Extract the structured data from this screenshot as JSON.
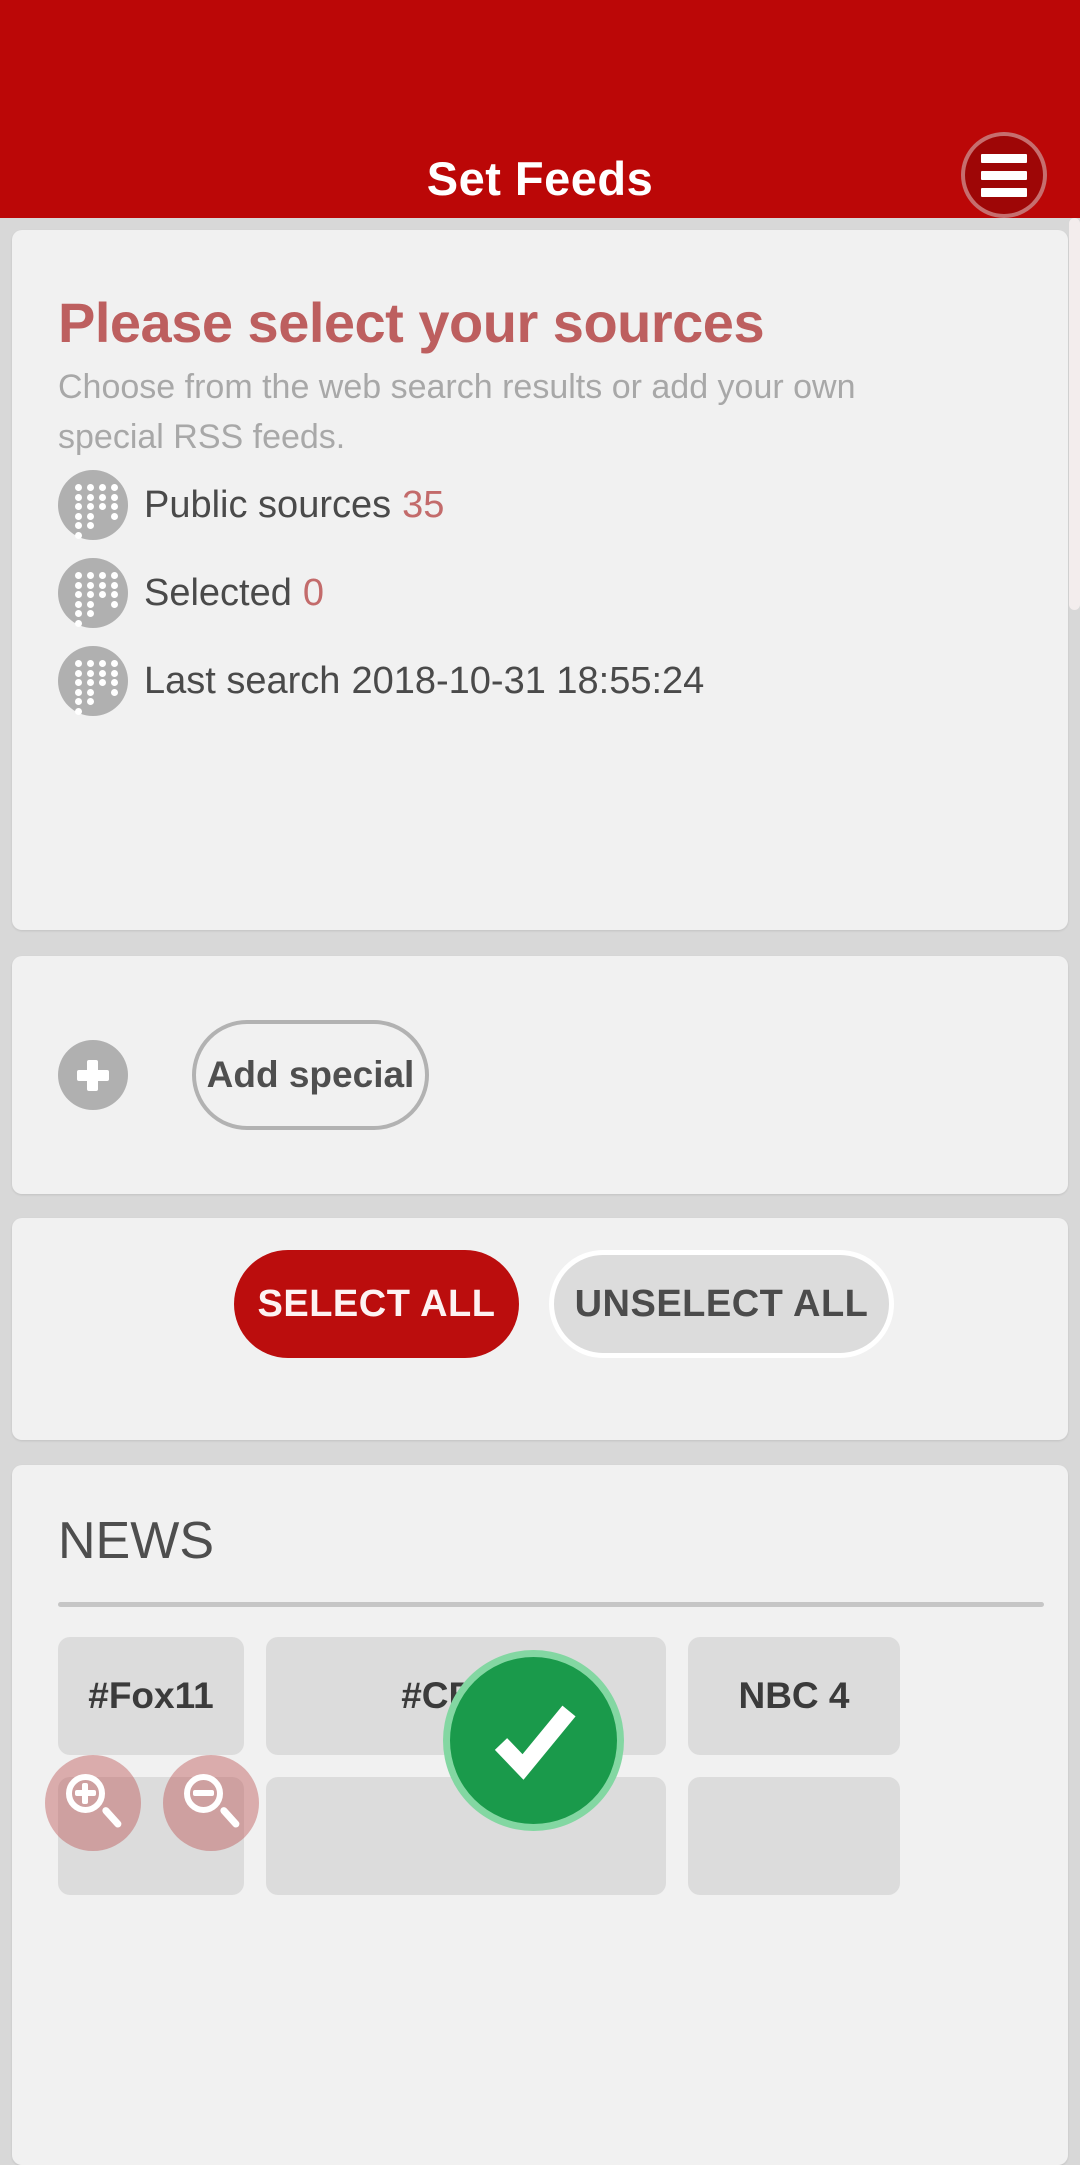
{
  "header": {
    "title": "Set Feeds",
    "menu_icon": "hamburger-menu-icon",
    "background_color": "#bb0707"
  },
  "info_card": {
    "heading": "Please select your sources",
    "subtitle": "Choose from the web search results or add your own special RSS feeds.",
    "heading_color": "#bd5f5f",
    "rows": [
      {
        "icon": "rss-dots-icon",
        "label": "Public sources",
        "value": "35"
      },
      {
        "icon": "rss-dots-icon",
        "label": "Selected",
        "value": "0"
      },
      {
        "icon": "rss-dots-icon",
        "label": "Last search",
        "value": "2018-10-31 18:55:24"
      }
    ],
    "value_color": "#c36b6b"
  },
  "add_card": {
    "plus_icon": "plus-icon",
    "button_label": "Add special"
  },
  "bulk_card": {
    "select_all_label": "SELECT ALL",
    "unselect_all_label": "UNSELECT ALL",
    "select_all_color": "#bb0d0d",
    "unselect_all_color": "#dcdcdc"
  },
  "news_card": {
    "title": "NEWS",
    "chips_row1": [
      "#Fox11",
      "#CBS 2",
      "NBC 4"
    ],
    "chips_row2": [
      "",
      "",
      ""
    ]
  },
  "overlays": {
    "zoom_in_icon": "magnifier-plus-icon",
    "zoom_out_icon": "magnifier-minus-icon",
    "confirm_icon": "checkmark-icon",
    "confirm_color": "#1a9a4b"
  },
  "scrollbar": {
    "thumb_color": "#f3eded"
  }
}
